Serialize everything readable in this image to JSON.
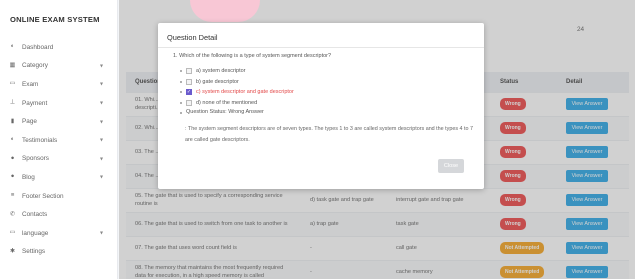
{
  "brand": "ONLINE EXAM SYSTEM",
  "sidebar": {
    "items": [
      {
        "label": "Dashboard",
        "icon": "dashboard-icon",
        "has_chevron": false
      },
      {
        "label": "Category",
        "icon": "category-icon",
        "has_chevron": true
      },
      {
        "label": "Exam",
        "icon": "exam-icon",
        "has_chevron": true
      },
      {
        "label": "Payment",
        "icon": "payment-icon",
        "has_chevron": true
      },
      {
        "label": "Page",
        "icon": "page-icon",
        "has_chevron": true
      },
      {
        "label": "Testimonials",
        "icon": "testimonials-icon",
        "has_chevron": true
      },
      {
        "label": "Sponsors",
        "icon": "sponsors-icon",
        "has_chevron": true
      },
      {
        "label": "Blog",
        "icon": "blog-icon",
        "has_chevron": true
      },
      {
        "label": "Footer Section",
        "icon": "footer-icon",
        "has_chevron": false
      },
      {
        "label": "Contacts",
        "icon": "contacts-icon",
        "has_chevron": false
      },
      {
        "label": "language",
        "icon": "language-icon",
        "has_chevron": true
      },
      {
        "label": "Settings",
        "icon": "settings-icon",
        "has_chevron": false
      }
    ]
  },
  "main": {
    "count": "24",
    "table": {
      "headers": [
        "Question",
        "",
        "",
        "Status",
        "Detail"
      ],
      "rows": [
        {
          "question": "01. Whi...",
          "question2": "descripti...",
          "ans": "",
          "correct": "",
          "status": "Wrong",
          "status_type": "wrong",
          "action": "View Answer"
        },
        {
          "question": "02. Whi...",
          "question2": "",
          "ans": "",
          "correct": "",
          "status": "Wrong",
          "status_type": "wrong",
          "action": "View Answer"
        },
        {
          "question": "03. The ...",
          "question2": "",
          "ans": "",
          "correct": "",
          "status": "Wrong",
          "status_type": "wrong",
          "action": "View Answer"
        },
        {
          "question": "04. The ...",
          "question2": "",
          "ans": "",
          "correct": "",
          "status": "Wrong",
          "status_type": "wrong",
          "action": "View Answer"
        },
        {
          "question": "05. The gate that is used to specify a corresponding service",
          "question2": "routine is",
          "ans": "d) task gate and trap gate",
          "correct": "interrupt gate and trap gate",
          "status": "Wrong",
          "status_type": "wrong",
          "action": "View Answer"
        },
        {
          "question": "06. The gate that is used to switch from one task to another is",
          "question2": "",
          "ans": "a) trap gate",
          "correct": "task gate",
          "status": "Wrong",
          "status_type": "wrong",
          "action": "View Answer"
        },
        {
          "question": "07. The gate that uses word count field is",
          "question2": "",
          "ans": "-",
          "correct": "call gate",
          "status": "Not Attempted",
          "status_type": "noattempt",
          "action": "View Answer"
        },
        {
          "question": "08. The memory that maintains the most frequently required",
          "question2": "data for execution, in a high speed memory is called",
          "ans": "-",
          "correct": "cache memory",
          "status": "Not Attempted",
          "status_type": "noattempt",
          "action": "View Answer"
        }
      ]
    }
  },
  "modal": {
    "title": "Question Detail",
    "question": "1. Which of the following is a type of system segment descriptor?",
    "options": [
      {
        "label": "a) system descriptor",
        "checked": false,
        "correct": false
      },
      {
        "label": "b) gate descriptor",
        "checked": false,
        "correct": false
      },
      {
        "label": "c) system descriptor and gate descriptor",
        "checked": true,
        "correct": true
      },
      {
        "label": "d) none of the mentioned",
        "checked": false,
        "correct": false
      }
    ],
    "status_line": "Question Status: Wrong Answer",
    "explanation": ": The system segment descriptors are of seven types. The types 1 to 3 are called system descriptors and the types 4 to 7 are called gate descriptors.",
    "close_label": "Close"
  },
  "colors": {
    "accent": "#2ea8e6",
    "wrong": "#ee4a4a",
    "not_attempted": "#f5a623",
    "checkbox": "#6a5acd",
    "correct_text": "#e24848"
  }
}
